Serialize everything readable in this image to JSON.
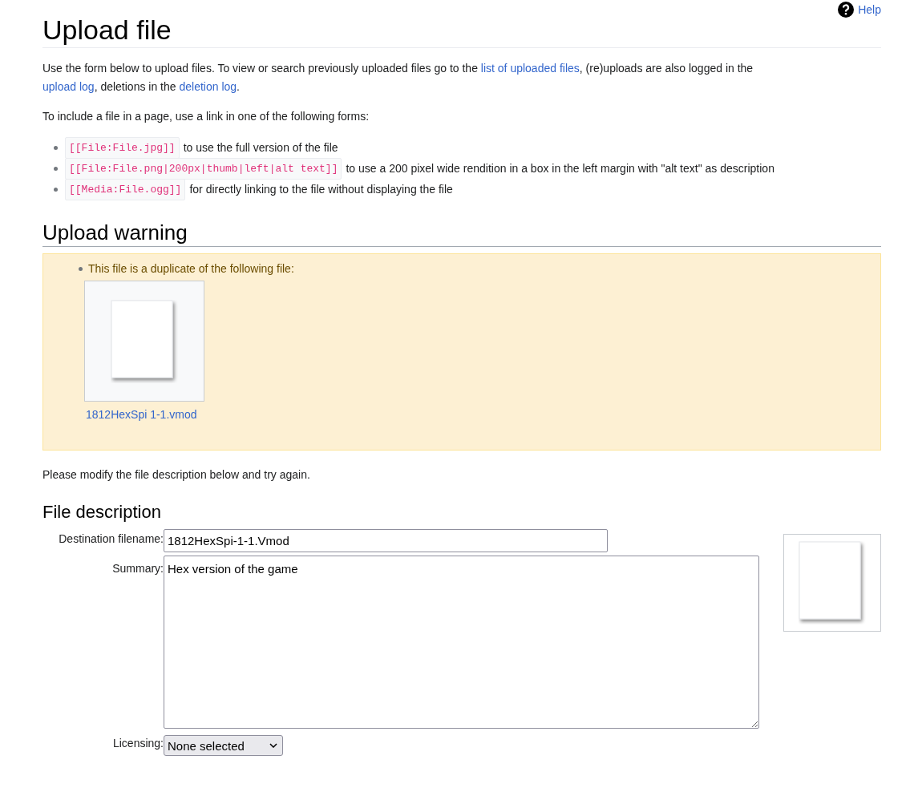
{
  "help_link": {
    "text": "Help"
  },
  "title": "Upload file",
  "intro": [
    {
      "kind": "text",
      "text": "Use the form below to upload files. To view or search previously uploaded files go to the "
    },
    {
      "kind": "link",
      "text": "list of uploaded files"
    },
    {
      "kind": "text",
      "text": ", (re)uploads are also logged in the "
    },
    {
      "kind": "link",
      "text": "upload log"
    },
    {
      "kind": "text",
      "text": ", deletions in the "
    },
    {
      "kind": "link",
      "text": "deletion log"
    },
    {
      "kind": "text",
      "text": "."
    }
  ],
  "forms_intro": "To include a file in a page, use a link in one of the following forms:",
  "link_forms": [
    {
      "code": "[[File:File.jpg]]",
      "text": "to use the full version of the file"
    },
    {
      "code": "[[File:File.png|200px|thumb|left|alt text]]",
      "text": "to use a 200 pixel wide rendition in a box in the left margin with \"alt text\" as description"
    },
    {
      "code": "[[Media:File.ogg]]",
      "text": "for directly linking to the file without displaying the file"
    }
  ],
  "warning": {
    "heading": "Upload warning",
    "message": "This file is a duplicate of the following file:",
    "duplicate_filename": "1812HexSpi 1-1.vmod"
  },
  "retry_note": "Please modify the file description below and try again.",
  "file_description": {
    "heading": "File description",
    "fields": [
      {
        "kind": "text",
        "label": "Destination filename:",
        "value": "1812HexSpi-1-1.Vmod"
      },
      {
        "kind": "textarea",
        "label": "Summary:",
        "value": "Hex version of the game"
      },
      {
        "kind": "select",
        "label": "Licensing:",
        "value": "None selected"
      }
    ]
  }
}
